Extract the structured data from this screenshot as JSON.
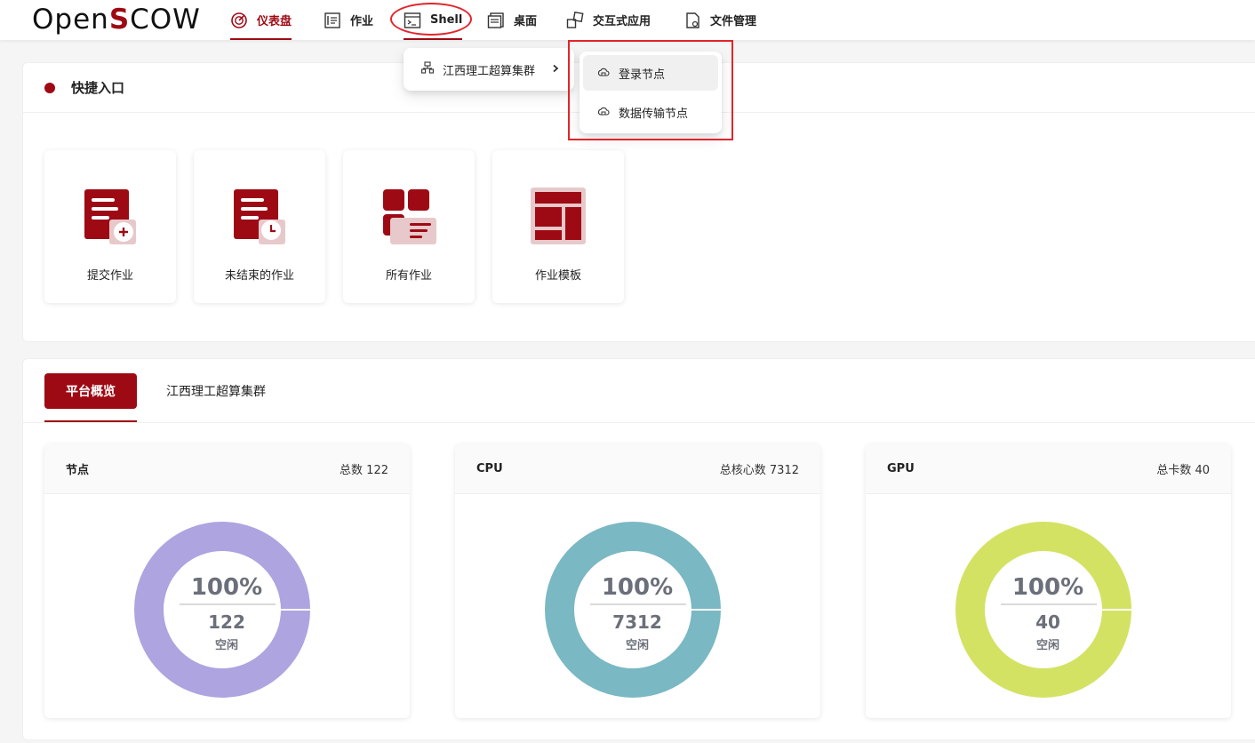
{
  "logo": {
    "prefix": "Open",
    "s": "S",
    "suffix": "COW"
  },
  "nav": [
    {
      "label": "仪表盘",
      "icon": "dashboard-icon",
      "active": true
    },
    {
      "label": "作业",
      "icon": "job-icon"
    },
    {
      "label": "Shell",
      "icon": "terminal-icon"
    },
    {
      "label": "桌面",
      "icon": "desktop-icon"
    },
    {
      "label": "交互式应用",
      "icon": "apps-icon"
    },
    {
      "label": "文件管理",
      "icon": "file-icon"
    }
  ],
  "dropdown": {
    "cluster": "江西理工超算集群",
    "options": [
      "登录节点",
      "数据传输节点"
    ]
  },
  "quick": {
    "title": "快捷入口",
    "tiles": [
      {
        "label": "提交作业",
        "icon": "submit-job-icon"
      },
      {
        "label": "未结束的作业",
        "icon": "running-jobs-icon"
      },
      {
        "label": "所有作业",
        "icon": "all-jobs-icon"
      },
      {
        "label": "作业模板",
        "icon": "job-template-icon"
      }
    ]
  },
  "overview": {
    "tabs": [
      "平台概览",
      "江西理工超算集群"
    ],
    "stats": [
      {
        "name": "节点",
        "total_label": "总数 122",
        "percent": "100%",
        "value": "122",
        "status": "空闲",
        "idle_fraction": 1.0,
        "color": "#ada4e0"
      },
      {
        "name": "CPU",
        "total_label": "总核心数 7312",
        "percent": "100%",
        "value": "7312",
        "status": "空闲",
        "idle_fraction": 1.0,
        "color": "#7ab8c3"
      },
      {
        "name": "GPU",
        "total_label": "总卡数 40",
        "percent": "100%",
        "value": "40",
        "status": "空闲",
        "idle_fraction": 1.0,
        "color": "#d4e264"
      }
    ]
  },
  "colors": {
    "brand": "#9e0a14",
    "annotation": "#e3242b"
  }
}
